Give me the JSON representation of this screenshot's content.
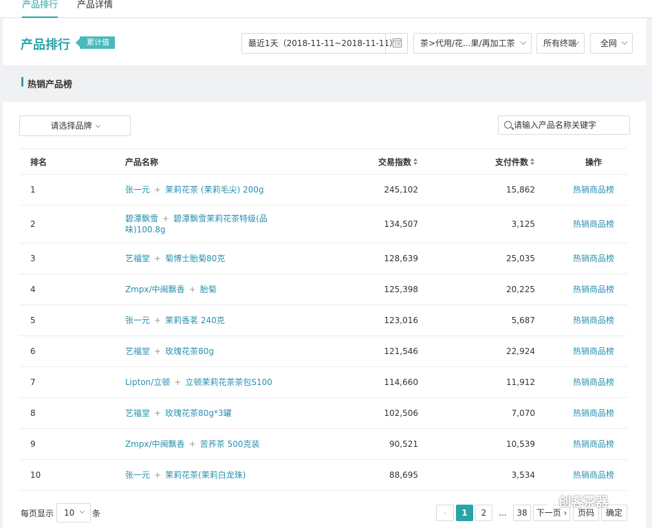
{
  "nav": {
    "tabs": [
      {
        "label": "产品排行",
        "active": true
      },
      {
        "label": "产品详情",
        "active": false
      }
    ]
  },
  "header": {
    "title": "产品排行",
    "badge": "累计值",
    "date_range": "最近1天（2018-11-11~2018-11-11）",
    "category": "茶>代用/花...果/再加工茶",
    "terminal": "所有终端",
    "channel": "全网"
  },
  "section": {
    "title": "热销产品榜"
  },
  "filters": {
    "brand_placeholder": "请选择品牌",
    "search_placeholder": "请输入产品名称关键字"
  },
  "table": {
    "headers": {
      "rank": "排名",
      "name": "产品名称",
      "trade_index": "交易指数",
      "pay_count": "支付件数",
      "action": "操作"
    },
    "rows": [
      {
        "rank": "1",
        "brand": "张一元",
        "product": "茉莉花茶 (茉莉毛尖) 200g",
        "trade_index": "245,102",
        "pay_count": "15,862",
        "action": "热销商品榜"
      },
      {
        "rank": "2",
        "brand": "碧潭飘雪",
        "product": "碧潭飘雪茉莉花茶特级(品味)100.8g",
        "trade_index": "134,507",
        "pay_count": "3,125",
        "action": "热销商品榜"
      },
      {
        "rank": "3",
        "brand": "艺福堂",
        "product": "菊博士胎菊80克",
        "trade_index": "128,639",
        "pay_count": "25,035",
        "action": "热销商品榜"
      },
      {
        "rank": "4",
        "brand": "Zmpx/中闽飘香",
        "product": "胎菊",
        "trade_index": "125,398",
        "pay_count": "20,225",
        "action": "热销商品榜"
      },
      {
        "rank": "5",
        "brand": "张一元",
        "product": "茉莉香茗 240克",
        "trade_index": "123,016",
        "pay_count": "5,687",
        "action": "热销商品榜"
      },
      {
        "rank": "6",
        "brand": "艺福堂",
        "product": "玫瑰花茶80g",
        "trade_index": "121,546",
        "pay_count": "22,924",
        "action": "热销商品榜"
      },
      {
        "rank": "7",
        "brand": "Lipton/立顿",
        "product": "立顿茉莉花茶茶包S100",
        "trade_index": "114,660",
        "pay_count": "11,912",
        "action": "热销商品榜"
      },
      {
        "rank": "8",
        "brand": "艺福堂",
        "product": "玫瑰花茶80g*3罐",
        "trade_index": "102,506",
        "pay_count": "7,070",
        "action": "热销商品榜"
      },
      {
        "rank": "9",
        "brand": "Zmpx/中闽飘香",
        "product": "苦荞茶 500克装",
        "trade_index": "90,521",
        "pay_count": "10,539",
        "action": "热销商品榜"
      },
      {
        "rank": "10",
        "brand": "张一元",
        "product": "茉莉花茶(茉莉白龙珠)",
        "trade_index": "88,695",
        "pay_count": "3,534",
        "action": "热销商品榜"
      }
    ]
  },
  "pagination": {
    "per_page_label": "每页显示",
    "per_page_value": "10",
    "per_page_unit": "条",
    "prev": "‹",
    "pages": [
      "1",
      "2"
    ],
    "ellipsis": "...",
    "last_page": "38",
    "next": "下一页 ›",
    "page_input_placeholder": "页码",
    "confirm": "确定"
  },
  "watermark": "创客茶器",
  "colors": {
    "accent": "#2aa3a8",
    "link": "#2a8fb0",
    "badge": "#49b9bd"
  }
}
